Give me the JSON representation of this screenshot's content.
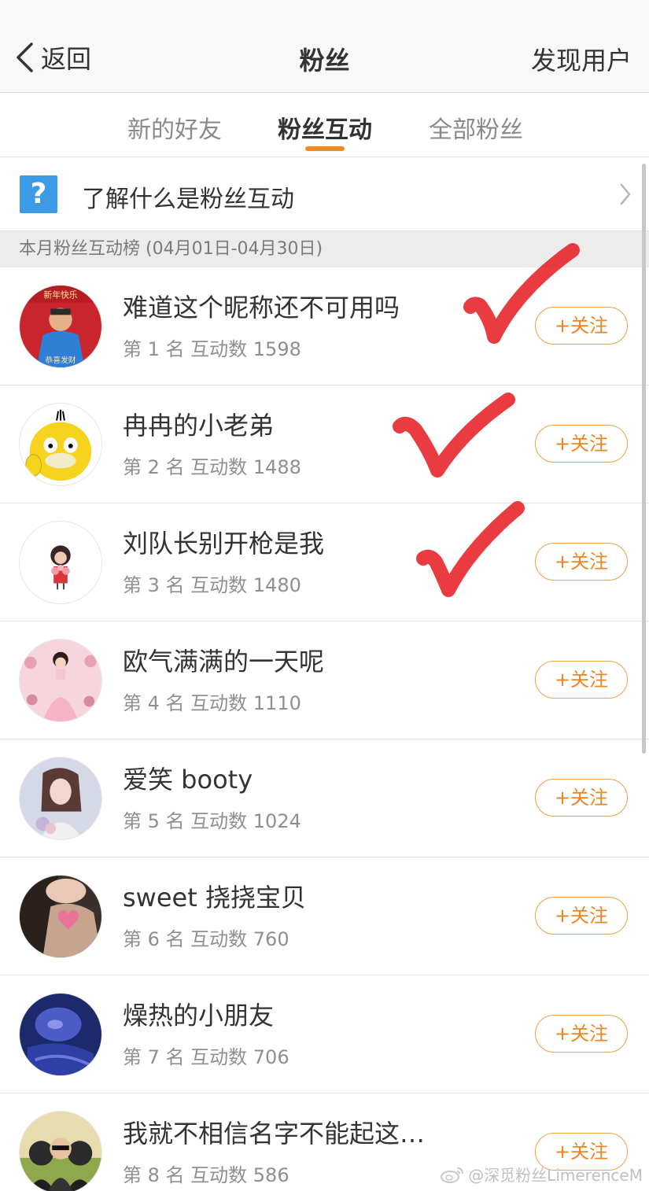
{
  "navbar": {
    "back_label": "返回",
    "title": "粉丝",
    "right_action": "发现用户"
  },
  "tabs": [
    {
      "label": "新的好友",
      "active": false
    },
    {
      "label": "粉丝互动",
      "active": true
    },
    {
      "label": "全部粉丝",
      "active": false
    }
  ],
  "info": {
    "icon": "?",
    "text": "了解什么是粉丝互动"
  },
  "section_header": "本月粉丝互动榜 (04月01日-04月30日)",
  "follow_label": "+关注",
  "fans": [
    {
      "name": "难道这个昵称还不可用吗",
      "rank": "第 1 名  互动数 1598",
      "follow": "+关注",
      "checked": true
    },
    {
      "name": "冉冉的小老弟",
      "rank": "第 2 名  互动数 1488",
      "follow": "+关注",
      "checked": true
    },
    {
      "name": "刘队长别开枪是我",
      "rank": "第 3 名  互动数 1480",
      "follow": "+关注",
      "checked": true
    },
    {
      "name": "欧气满满的一天呢",
      "rank": "第 4 名  互动数 1110",
      "follow": "+关注",
      "checked": false
    },
    {
      "name": "爱笑 booty",
      "rank": "第 5 名  互动数 1024",
      "follow": "+关注",
      "checked": false
    },
    {
      "name": "sweet 挠挠宝贝",
      "rank": "第 6 名  互动数 760",
      "follow": "+关注",
      "checked": false
    },
    {
      "name": "燥热的小朋友",
      "rank": "第 7 名  互动数 706",
      "follow": "+关注",
      "checked": false
    },
    {
      "name": "我就不相信名字不能起这…",
      "rank": "第 8 名  互动数 586",
      "follow": "+关注",
      "checked": false
    }
  ],
  "watermark": "@深觅粉丝LimerenceM",
  "colors": {
    "accent": "#f08420",
    "check_red": "#e8262b",
    "question_blue": "#3c9be5"
  }
}
